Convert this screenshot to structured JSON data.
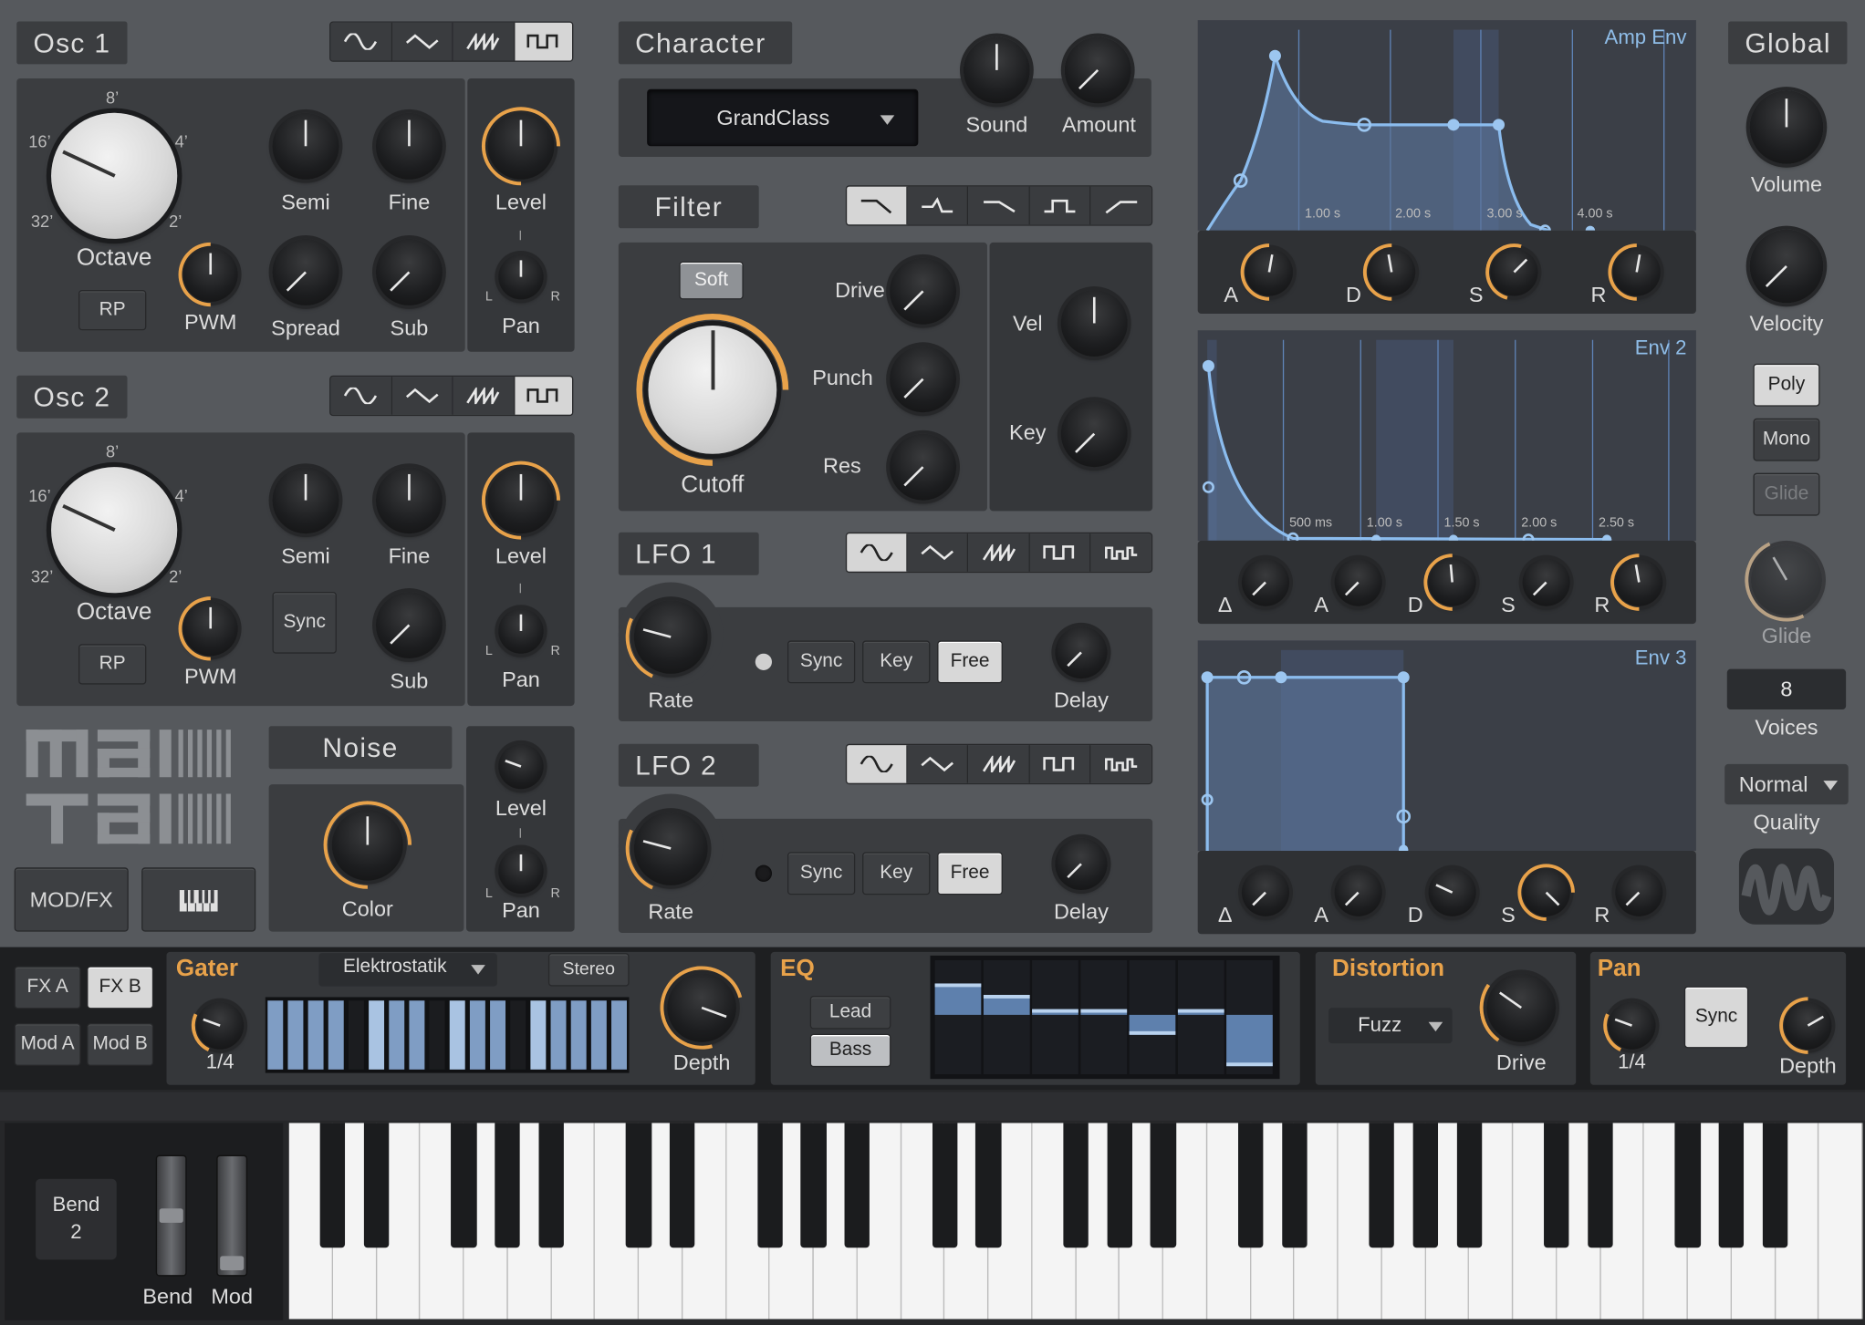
{
  "osc1": {
    "title": "Osc 1",
    "octave_label": "Octave",
    "rp": "RP",
    "pwm": "PWM",
    "semi": "Semi",
    "fine": "Fine",
    "level": "Level",
    "spread": "Spread",
    "sub": "Sub",
    "pan": "Pan",
    "oct_marks": [
      "8’",
      "4’",
      "2’",
      "32’",
      "16’"
    ],
    "pan_l": "L",
    "pan_r": "R",
    "waves": [
      "sine",
      "triangle",
      "saw",
      "square"
    ]
  },
  "osc2": {
    "title": "Osc 2",
    "octave_label": "Octave",
    "rp": "RP",
    "pwm": "PWM",
    "semi": "Semi",
    "fine": "Fine",
    "level": "Level",
    "sync": "Sync",
    "sub": "Sub",
    "pan": "Pan",
    "oct_marks": [
      "8’",
      "4’",
      "2’",
      "32’",
      "16’"
    ],
    "pan_l": "L",
    "pan_r": "R"
  },
  "noise": {
    "title": "Noise",
    "color": "Color",
    "level": "Level",
    "pan": "Pan",
    "pan_l": "L",
    "pan_r": "R"
  },
  "logo": {
    "line1": "mai",
    "line2": "tai"
  },
  "bottom_left": {
    "modfx": "MOD/FX",
    "keyboard_icon": "piano-icon"
  },
  "character": {
    "title": "Character",
    "preset": "GrandClass",
    "sound": "Sound",
    "amount": "Amount"
  },
  "filter": {
    "title": "Filter",
    "soft": "Soft",
    "cutoff": "Cutoff",
    "drive": "Drive",
    "punch": "Punch",
    "res": "Res",
    "vel": "Vel",
    "key": "Key"
  },
  "lfo1": {
    "title": "LFO 1",
    "rate": "Rate",
    "sync": "Sync",
    "key": "Key",
    "free": "Free",
    "delay": "Delay"
  },
  "lfo2": {
    "title": "LFO 2",
    "rate": "Rate",
    "sync": "Sync",
    "key": "Key",
    "free": "Free",
    "delay": "Delay"
  },
  "amp_env": {
    "title": "Amp Env",
    "times": [
      "1.00 s",
      "2.00 s",
      "3.00 s",
      "4.00 s"
    ],
    "knobs": [
      "A",
      "D",
      "S",
      "R"
    ]
  },
  "env2": {
    "title": "Env 2",
    "times": [
      "500 ms",
      "1.00 s",
      "1.50 s",
      "2.00 s",
      "2.50 s"
    ],
    "knobs": [
      "Δ",
      "A",
      "D",
      "S",
      "R"
    ]
  },
  "env3": {
    "title": "Env 3",
    "knobs": [
      "Δ",
      "A",
      "D",
      "S",
      "R"
    ]
  },
  "global": {
    "title": "Global",
    "volume": "Volume",
    "velocity": "Velocity",
    "poly": "Poly",
    "mono": "Mono",
    "glide_btn": "Glide",
    "glide": "Glide",
    "voices_value": "8",
    "voices": "Voices",
    "quality_value": "Normal",
    "quality": "Quality"
  },
  "fx": {
    "fxa": "FX A",
    "fxb": "FX B",
    "moda": "Mod A",
    "modb": "Mod B"
  },
  "gater": {
    "title": "Gater",
    "preset": "Elektrostatik",
    "stereo": "Stereo",
    "rate": "1/4",
    "depth": "Depth",
    "steps": [
      0.85,
      0.85,
      0.85,
      0.85,
      0,
      0.95,
      0.85,
      0.85,
      0,
      0.95,
      0.85,
      0.85,
      0,
      0.95,
      0.85,
      0.85,
      0.85,
      0.85
    ]
  },
  "eq": {
    "title": "EQ",
    "lead": "Lead",
    "bass": "Bass",
    "bands": [
      0.55,
      0.35,
      0.1,
      0.1,
      -0.35,
      0.1,
      -0.9
    ]
  },
  "distortion": {
    "title": "Distortion",
    "type": "Fuzz",
    "drive": "Drive"
  },
  "pan_fx": {
    "title": "Pan",
    "sync": "Sync",
    "rate": "1/4",
    "depth": "Depth"
  },
  "keys": {
    "bend_box": "Bend",
    "bend_value": "2",
    "bend": "Bend",
    "mod": "Mod"
  },
  "colors": {
    "accent": "#e8a24a",
    "env_line": "#7fb2e6",
    "panel": "#3b3d40"
  }
}
